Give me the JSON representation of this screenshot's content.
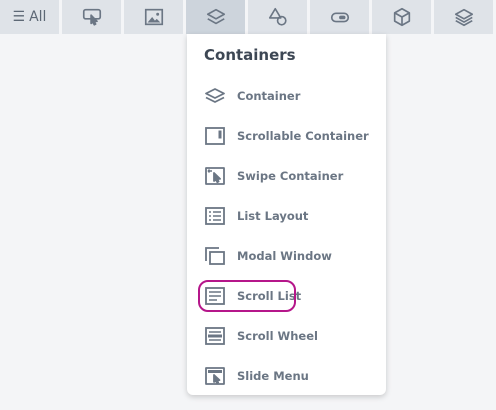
{
  "toolbar": {
    "all_label": "All",
    "buttons": [
      {
        "icon": "hand-tap-icon"
      },
      {
        "icon": "image-icon"
      },
      {
        "icon": "layers-icon",
        "active": true
      },
      {
        "icon": "shapes-icon"
      },
      {
        "icon": "toggle-icon"
      },
      {
        "icon": "cube-icon"
      },
      {
        "icon": "stack-icon"
      }
    ]
  },
  "dropdown": {
    "title": "Containers",
    "items": [
      {
        "label": "Container",
        "icon": "layers-icon"
      },
      {
        "label": "Scrollable Container",
        "icon": "scrollable-container-icon"
      },
      {
        "label": "Swipe Container",
        "icon": "swipe-container-icon"
      },
      {
        "label": "List Layout",
        "icon": "list-layout-icon"
      },
      {
        "label": "Modal Window",
        "icon": "modal-window-icon"
      },
      {
        "label": "Scroll List",
        "icon": "scroll-list-icon",
        "highlighted": true
      },
      {
        "label": "Scroll Wheel",
        "icon": "scroll-wheel-icon"
      },
      {
        "label": "Slide Menu",
        "icon": "slide-menu-icon"
      }
    ]
  },
  "colors": {
    "toolbar_bg": "#dfe3e8",
    "toolbar_active": "#cdd4dc",
    "icon": "#6b7684",
    "highlight_ring": "#b5168a"
  }
}
